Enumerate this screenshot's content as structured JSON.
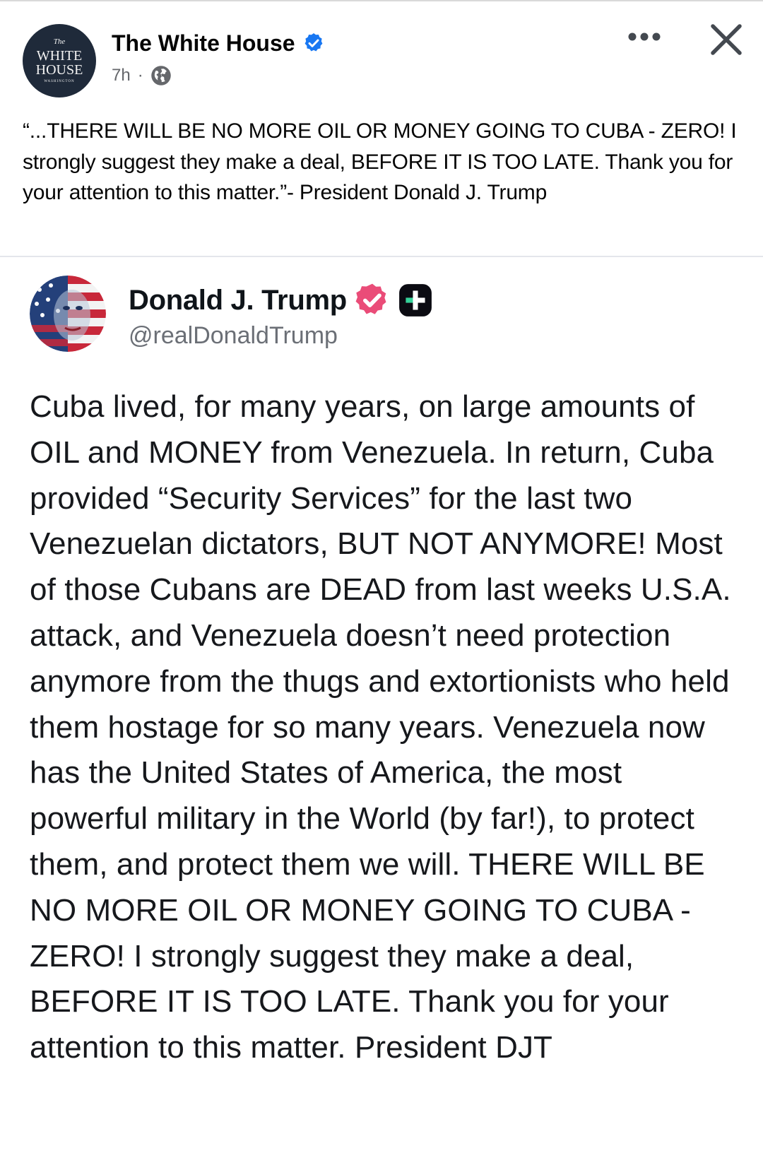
{
  "post": {
    "page_name": "The White House",
    "avatar_text": {
      "top": "The",
      "line1": "WHITE",
      "line2": "HOUSE",
      "bottom": "WASHINGTON"
    },
    "time_ago": "7h",
    "separator": "·",
    "icons": {
      "verified": "verified-badge-icon",
      "audience": "globe-icon",
      "more": "more-options-icon",
      "close": "close-icon"
    },
    "caption": "“...THERE WILL BE NO MORE OIL OR MONEY GOING TO CUBA - ZERO! I strongly suggest they make a deal, BEFORE IT IS TOO LATE. Thank you for your attention to this matter.”- President Donald J. Trump"
  },
  "embedded": {
    "display_name": "Donald J. Trump",
    "handle": "@realDonaldTrump",
    "body": "Cuba lived, for many years, on large amounts of OIL and MONEY from Venezuela. In return, Cuba provided “Security Services” for the last two Venezuelan dictators, BUT NOT ANYMORE! Most of those Cubans are DEAD from last weeks U.S.A. attack, and Venezuela doesn’t need protection anymore from the thugs and extortionists who held them hostage for so many years. Venezuela now has the United States of America, the most powerful military in the World (by far!), to protect them, and protect them we will. THERE WILL BE NO MORE OIL OR MONEY GOING TO CUBA - ZERO! I strongly suggest they make a deal, BEFORE IT IS TOO LATE. Thank you for your attention to this matter. President DJT",
    "icons": {
      "verified": "verified-badge-icon",
      "subscriber": "truth-plus-icon"
    }
  },
  "colors": {
    "facebook_blue": "#1877f2",
    "truth_verified": "#ea4c78",
    "text_primary": "#050505",
    "text_secondary": "#65676b"
  }
}
